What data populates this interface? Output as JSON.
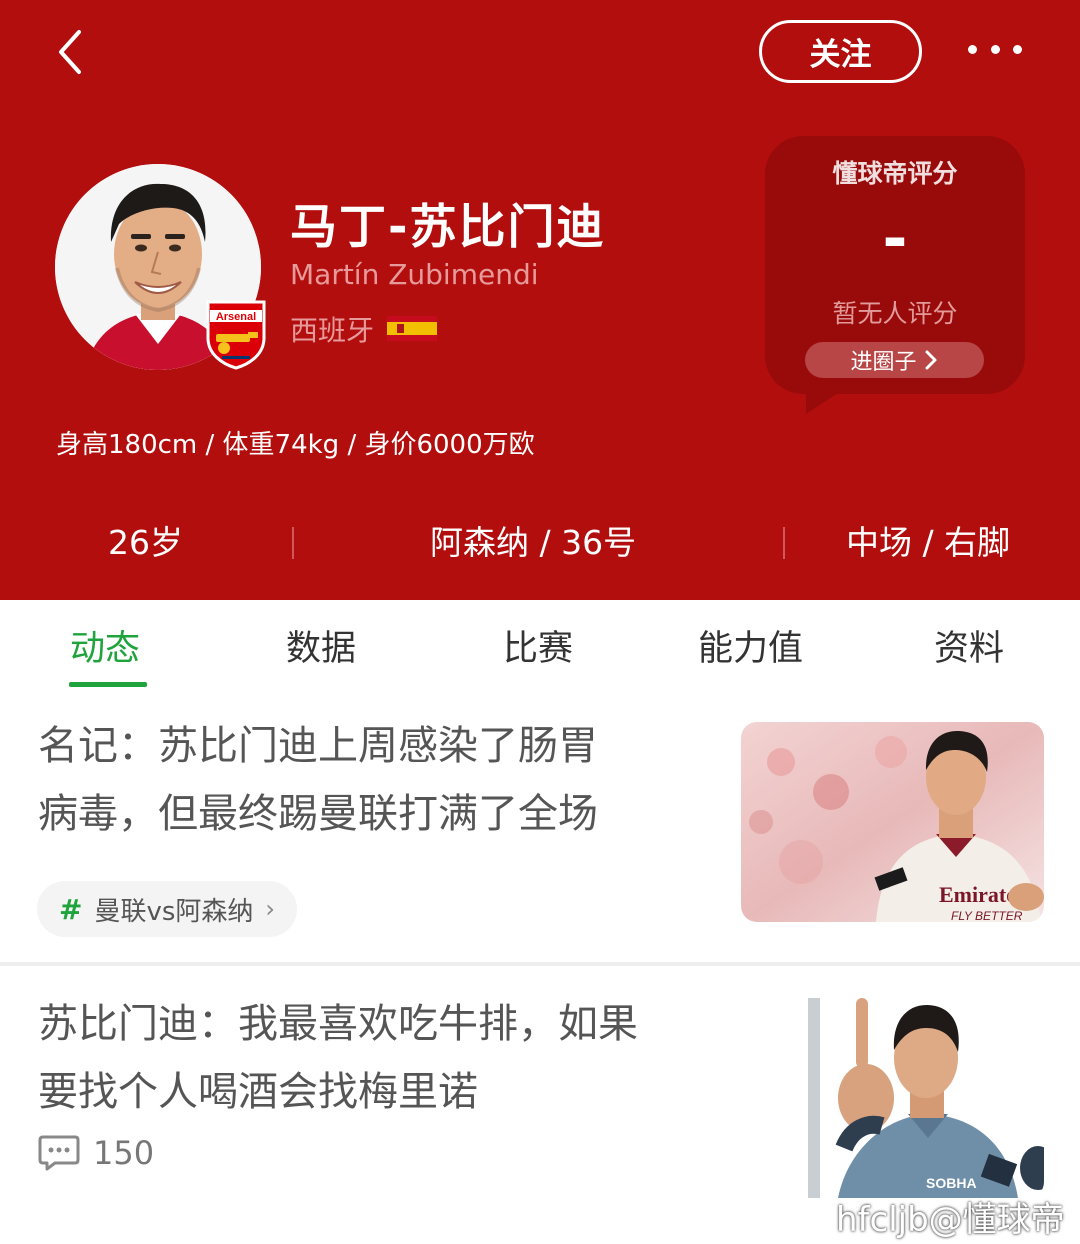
{
  "header": {
    "follow_label": "关注",
    "bg_color": "#b30e0e"
  },
  "player": {
    "name_cn": "马丁-苏比门迪",
    "name_en": "Martín Zubimendi",
    "country": "西班牙",
    "club_badge_text": "Arsenal",
    "stats_line": "身高180cm / 体重74kg / 身价6000万欧"
  },
  "rating": {
    "title": "懂球帝评分",
    "value": "-",
    "empty_text": "暂无人评分",
    "enter_label": "进圈子"
  },
  "info_row": {
    "age": "26岁",
    "club_number": "阿森纳 / 36号",
    "position_foot": "中场 / 右脚"
  },
  "tabs": [
    {
      "label": "动态",
      "active": true
    },
    {
      "label": "数据",
      "active": false
    },
    {
      "label": "比赛",
      "active": false
    },
    {
      "label": "能力值",
      "active": false
    },
    {
      "label": "资料",
      "active": false
    }
  ],
  "feed": [
    {
      "title_line1": "名记：苏比门迪上周感染了肠胃",
      "title_line2": "病毒，但最终踢曼联打满了全场",
      "topic": "曼联vs阿森纳",
      "thumb_text_1": "Emirates",
      "thumb_text_2": "FLY BETTER"
    },
    {
      "title_line1": "苏比门迪：我最喜欢吃牛排，如果",
      "title_line2": "要找个人喝酒会找梅里诺",
      "comment_count": "150",
      "thumb_text_1": "SOBHA"
    }
  ],
  "watermark": "hfcljb@懂球帝",
  "colors": {
    "accent_green": "#1fa33c",
    "header_red": "#b30e0e",
    "card_red": "#990b0b"
  }
}
